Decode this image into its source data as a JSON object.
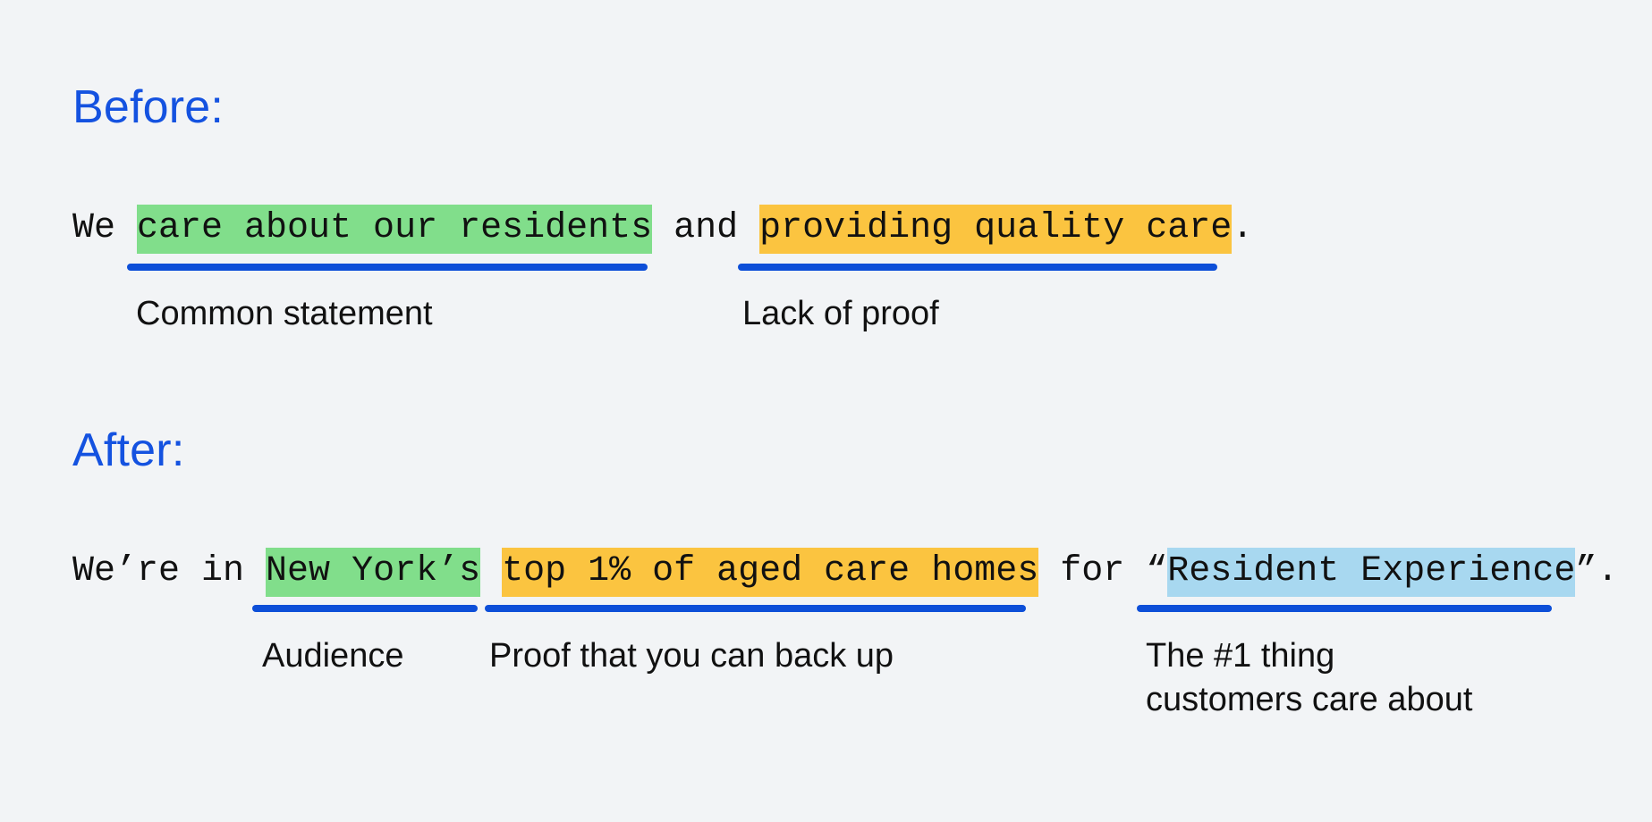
{
  "theme": {
    "background": "#f2f4f6",
    "accent_blue": "#1452e0",
    "underline_blue": "#0d4fd8",
    "highlight_green": "#81de8b",
    "highlight_orange": "#fbc440",
    "highlight_blue": "#a8d8f0",
    "text_black": "#111111"
  },
  "before": {
    "heading": "Before:",
    "sentence": {
      "lead": "We ",
      "green": "care about our residents",
      "middle": " and ",
      "orange": "providing quality care",
      "trail": "."
    },
    "captions": [
      {
        "label": "Common  statement"
      },
      {
        "label": "Lack of proof"
      }
    ]
  },
  "after": {
    "heading": "After:",
    "sentence": {
      "lead": "We’re in ",
      "green": "New York’s",
      "gap1": " ",
      "orange": "top 1% of aged care homes",
      "middle": " for “",
      "blue": "Resident Experience",
      "trail": "”."
    },
    "captions": [
      {
        "label": "Audience"
      },
      {
        "label": "Proof that you can back up"
      },
      {
        "label": "The #1 thing\ncustomers care about"
      }
    ]
  }
}
